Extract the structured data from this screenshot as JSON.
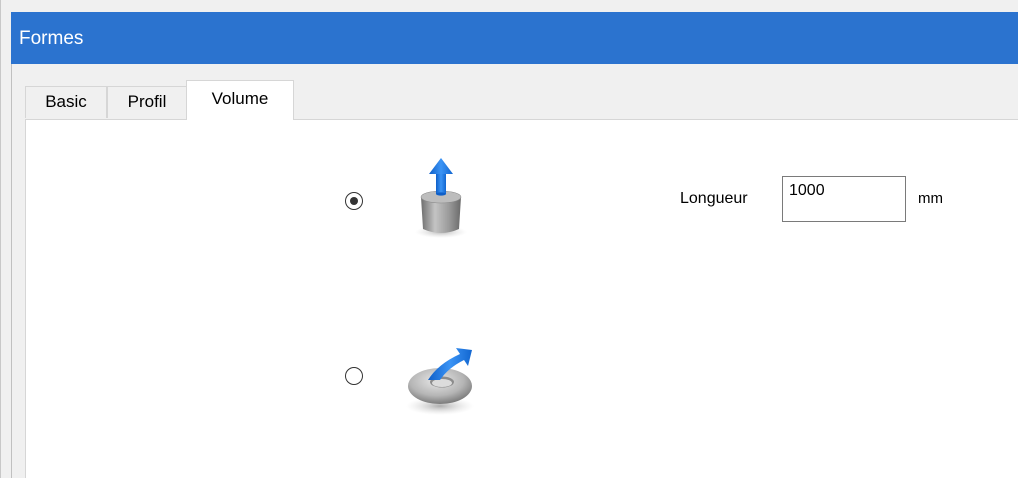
{
  "window": {
    "title": "Formes"
  },
  "tabs": [
    {
      "label": "Basic",
      "active": false
    },
    {
      "label": "Profil",
      "active": false
    },
    {
      "label": "Volume",
      "active": true
    }
  ],
  "volume": {
    "options": [
      {
        "icon": "extrude-icon",
        "selected": true
      },
      {
        "icon": "revolve-icon",
        "selected": false
      }
    ],
    "length": {
      "label": "Longueur",
      "value": "1000",
      "unit": "mm"
    }
  },
  "colors": {
    "titlebar": "#2b73cf",
    "accent_arrow": "#1e7be8"
  }
}
